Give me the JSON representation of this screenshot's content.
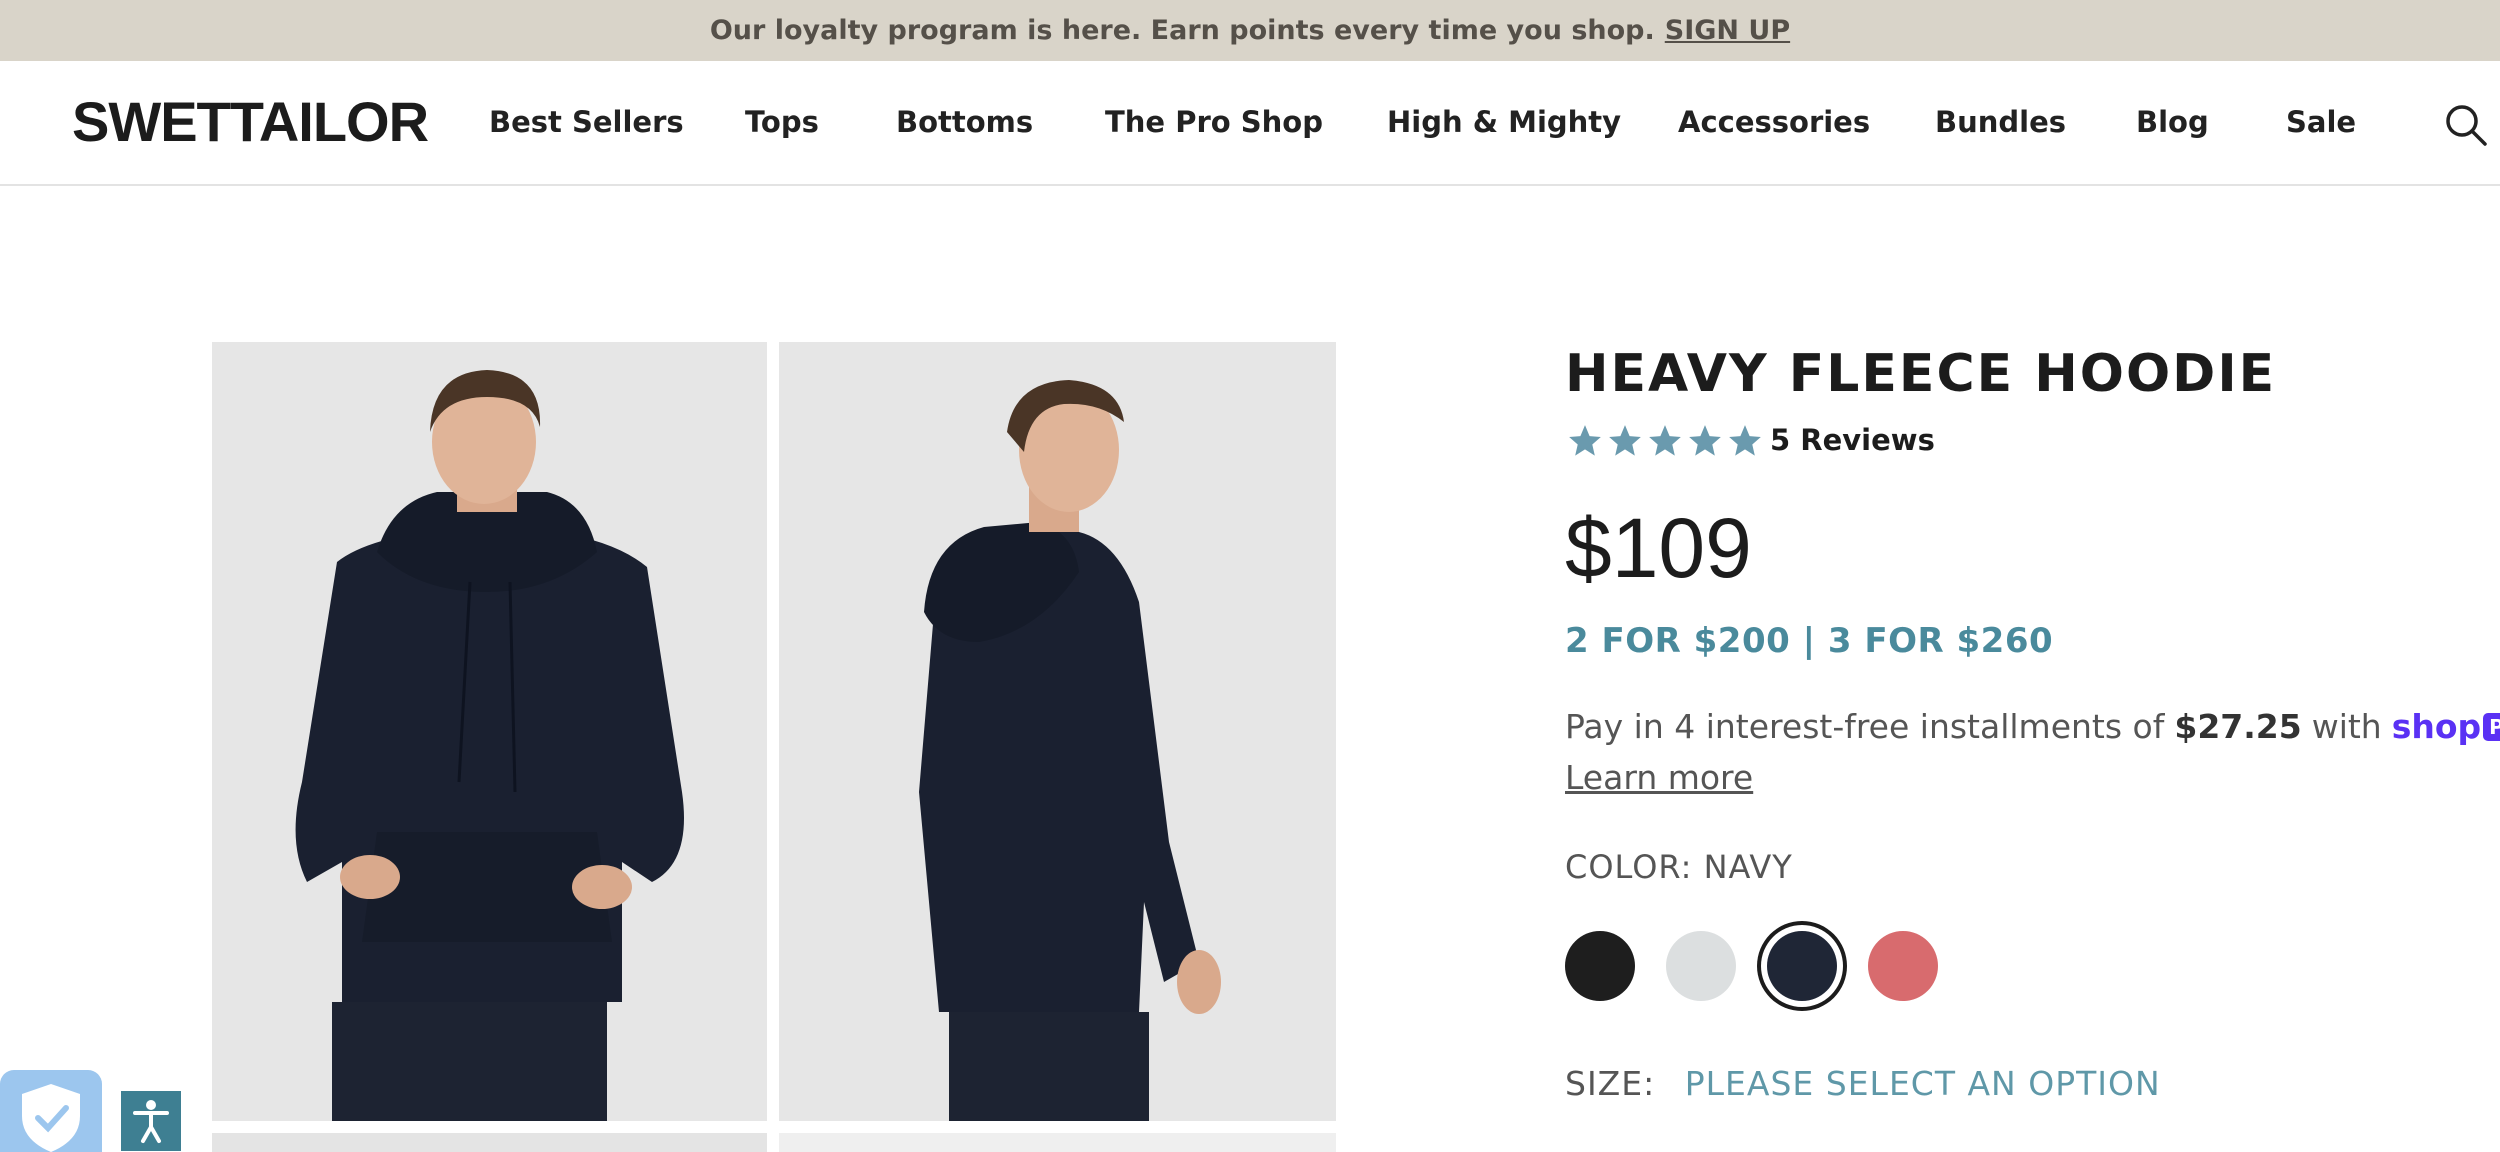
{
  "banner": {
    "text": "Our loyalty program is here. Earn points every time you shop.",
    "link": "SIGN UP"
  },
  "header": {
    "logo": "SWETTAILOR",
    "nav": [
      "Best Sellers",
      "Tops",
      "Bottoms",
      "The Pro Shop",
      "High & Mighty",
      "Accessories",
      "Bundles",
      "Blog",
      "Sale"
    ]
  },
  "product": {
    "title": "HEAVY FLEECE HOODIE",
    "rating": 5,
    "reviews": "5 Reviews",
    "price": "$109",
    "bundle": "2 FOR $200 | 3 FOR $260",
    "installments": {
      "prefix": "Pay in 4 interest-free installments of",
      "amount": "$27.25",
      "with": "with",
      "shop": "shop",
      "pay": "Pay",
      "learn": "Learn more"
    },
    "color_label": "COLOR: NAVY",
    "swatches": [
      {
        "name": "Black",
        "color": "#1e1e1e"
      },
      {
        "name": "Light Grey",
        "color": "#dcdfe0"
      },
      {
        "name": "Navy",
        "color": "#1f2636",
        "selected": true
      },
      {
        "name": "Red",
        "color": "#d86b6e"
      }
    ],
    "size_label": "SIZE:",
    "size_option": "PLEASE SELECT AN OPTION"
  },
  "colors": {
    "accent": "#4a8a9c",
    "star": "#6a9aae",
    "banner_bg": "#d9d4c9",
    "shoppay": "#5a31f4"
  }
}
